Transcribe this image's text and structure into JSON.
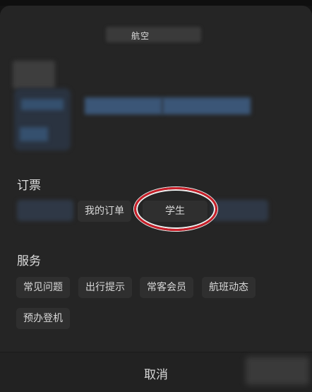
{
  "header": {
    "title": "航空"
  },
  "booking": {
    "section_title": "订票",
    "items": [
      {
        "label": "我的订单"
      },
      {
        "label": "学生"
      }
    ]
  },
  "services": {
    "section_title": "服务",
    "items": [
      {
        "label": "常见问题"
      },
      {
        "label": "出行提示"
      },
      {
        "label": "常客会员"
      },
      {
        "label": "航班动态"
      },
      {
        "label": "预办登机"
      }
    ]
  },
  "footer": {
    "cancel_label": "取消"
  },
  "colors": {
    "sheet_background": "#252525",
    "chip_background": "#2f2f2f",
    "highlight_ring": "#c81e28"
  }
}
